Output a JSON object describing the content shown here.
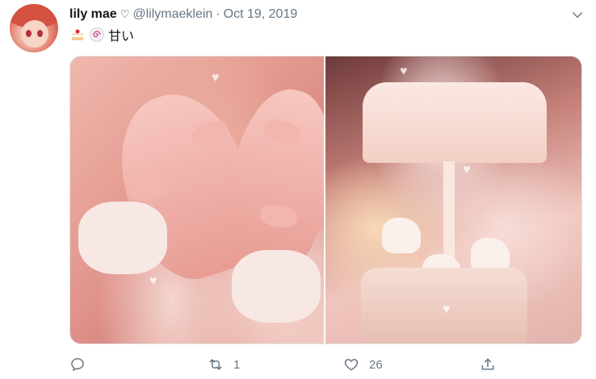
{
  "tweet": {
    "display_name": "lily mae",
    "name_symbol": "♡",
    "handle": "@lilymaeklein",
    "separator": "·",
    "date": "Oct 19, 2019",
    "text": "甘い",
    "emojis": [
      "cake-emoji",
      "fish-cake-emoji"
    ]
  },
  "media": {
    "photos": [
      {
        "subject": "pink shoes with bows"
      },
      {
        "subject": "pink carousel music box"
      }
    ]
  },
  "actions": {
    "reply": {
      "icon": "reply-icon",
      "count": ""
    },
    "retweet": {
      "icon": "retweet-icon",
      "count": "1"
    },
    "like": {
      "icon": "heart-icon",
      "count": "26"
    },
    "share": {
      "icon": "share-icon",
      "count": ""
    }
  },
  "colors": {
    "text_primary": "#14171a",
    "text_secondary": "#657786",
    "border": "#e1e8ed"
  }
}
